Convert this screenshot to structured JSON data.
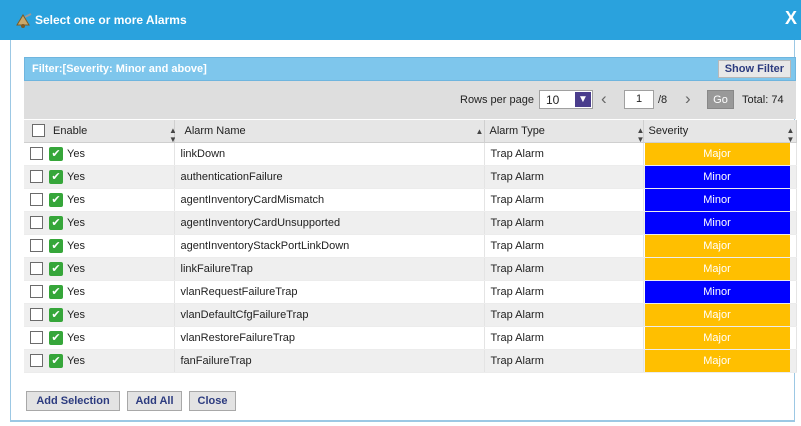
{
  "dialog": {
    "title": "Select one or more Alarms",
    "close_symbol": "X"
  },
  "filter": {
    "text": "Filter:[Severity: Minor and above]",
    "show_filter_label": "Show Filter"
  },
  "pager": {
    "rows_per_page_label": "Rows per page",
    "rows_per_page_value": "10",
    "current_page": "1",
    "page_of": "/8",
    "go_label": "Go",
    "total_label": "Total: 74"
  },
  "columns": {
    "enable": "Enable",
    "alarm_name": "Alarm Name",
    "alarm_type": "Alarm Type",
    "severity": "Severity"
  },
  "rows": [
    {
      "enabled": "Yes",
      "name": "linkDown",
      "type": "Trap Alarm",
      "severity": "Major"
    },
    {
      "enabled": "Yes",
      "name": "authenticationFailure",
      "type": "Trap Alarm",
      "severity": "Minor"
    },
    {
      "enabled": "Yes",
      "name": "agentInventoryCardMismatch",
      "type": "Trap Alarm",
      "severity": "Minor"
    },
    {
      "enabled": "Yes",
      "name": "agentInventoryCardUnsupported",
      "type": "Trap Alarm",
      "severity": "Minor"
    },
    {
      "enabled": "Yes",
      "name": "agentInventoryStackPortLinkDown",
      "type": "Trap Alarm",
      "severity": "Major"
    },
    {
      "enabled": "Yes",
      "name": "linkFailureTrap",
      "type": "Trap Alarm",
      "severity": "Major"
    },
    {
      "enabled": "Yes",
      "name": "vlanRequestFailureTrap",
      "type": "Trap Alarm",
      "severity": "Minor"
    },
    {
      "enabled": "Yes",
      "name": "vlanDefaultCfgFailureTrap",
      "type": "Trap Alarm",
      "severity": "Major"
    },
    {
      "enabled": "Yes",
      "name": "vlanRestoreFailureTrap",
      "type": "Trap Alarm",
      "severity": "Major"
    },
    {
      "enabled": "Yes",
      "name": "fanFailureTrap",
      "type": "Trap Alarm",
      "severity": "Major"
    }
  ],
  "severity_colors": {
    "Major": "#ffbf00",
    "Minor": "#0000ff"
  },
  "buttons": {
    "add_selection": "Add Selection",
    "add_all": "Add All",
    "close": "Close"
  },
  "colors": {
    "title_bar": "#2aa2dd",
    "filter_bar": "#7ec6ec",
    "enabled_check": "#36a63a"
  }
}
